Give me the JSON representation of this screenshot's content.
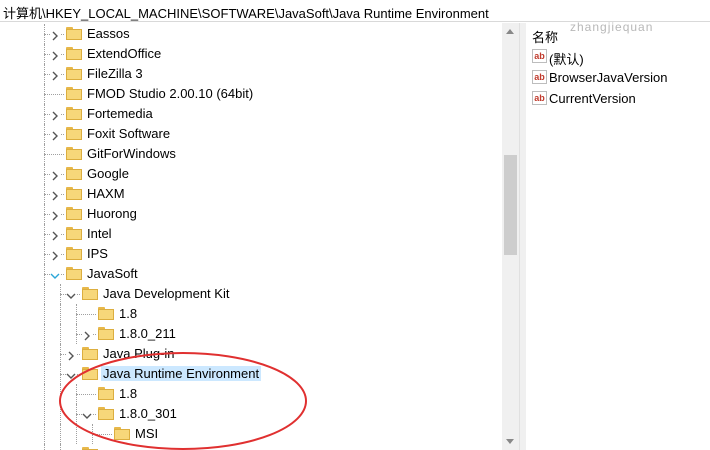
{
  "address": "计算机\\HKEY_LOCAL_MACHINE\\SOFTWARE\\JavaSoft\\Java Runtime Environment",
  "tree": {
    "items": [
      {
        "label": "Eassos",
        "level": 0,
        "expander": "collapsed"
      },
      {
        "label": "ExtendOffice",
        "level": 0,
        "expander": "collapsed"
      },
      {
        "label": "FileZilla 3",
        "level": 0,
        "expander": "collapsed"
      },
      {
        "label": "FMOD Studio 2.00.10 (64bit)",
        "level": 0,
        "expander": "none"
      },
      {
        "label": "Fortemedia",
        "level": 0,
        "expander": "collapsed"
      },
      {
        "label": "Foxit Software",
        "level": 0,
        "expander": "collapsed"
      },
      {
        "label": "GitForWindows",
        "level": 0,
        "expander": "none"
      },
      {
        "label": "Google",
        "level": 0,
        "expander": "collapsed"
      },
      {
        "label": "HAXM",
        "level": 0,
        "expander": "collapsed"
      },
      {
        "label": "Huorong",
        "level": 0,
        "expander": "collapsed"
      },
      {
        "label": "Intel",
        "level": 0,
        "expander": "collapsed"
      },
      {
        "label": "IPS",
        "level": 0,
        "expander": "collapsed"
      },
      {
        "label": "JavaSoft",
        "level": 0,
        "expander": "expanded"
      },
      {
        "label": "Java Development Kit",
        "level": 1,
        "expander": "expanded"
      },
      {
        "label": "1.8",
        "level": 2,
        "expander": "none"
      },
      {
        "label": "1.8.0_211",
        "level": 2,
        "expander": "collapsed"
      },
      {
        "label": "Java Plug-in",
        "level": 1,
        "expander": "collapsed"
      },
      {
        "label": "Java Runtime Environment",
        "level": 1,
        "expander": "expanded",
        "selected": true
      },
      {
        "label": "1.8",
        "level": 2,
        "expander": "none"
      },
      {
        "label": "1.8.0_301",
        "level": 2,
        "expander": "expanded"
      },
      {
        "label": "MSI",
        "level": 3,
        "expander": "none"
      },
      {
        "label": "",
        "level": 1,
        "expander": "collapsed"
      }
    ]
  },
  "values": {
    "header_name": "名称",
    "watermark": "zhangjiequan",
    "rows": [
      {
        "name": "(默认)",
        "icon": "ab"
      },
      {
        "name": "BrowserJavaVersion",
        "icon": "ab"
      },
      {
        "name": "CurrentVersion",
        "icon": "ab"
      }
    ]
  },
  "colors": {
    "selection": "#cce8ff",
    "annotation": "#e03030",
    "expander_expanded_root": "#2aa6d8"
  }
}
